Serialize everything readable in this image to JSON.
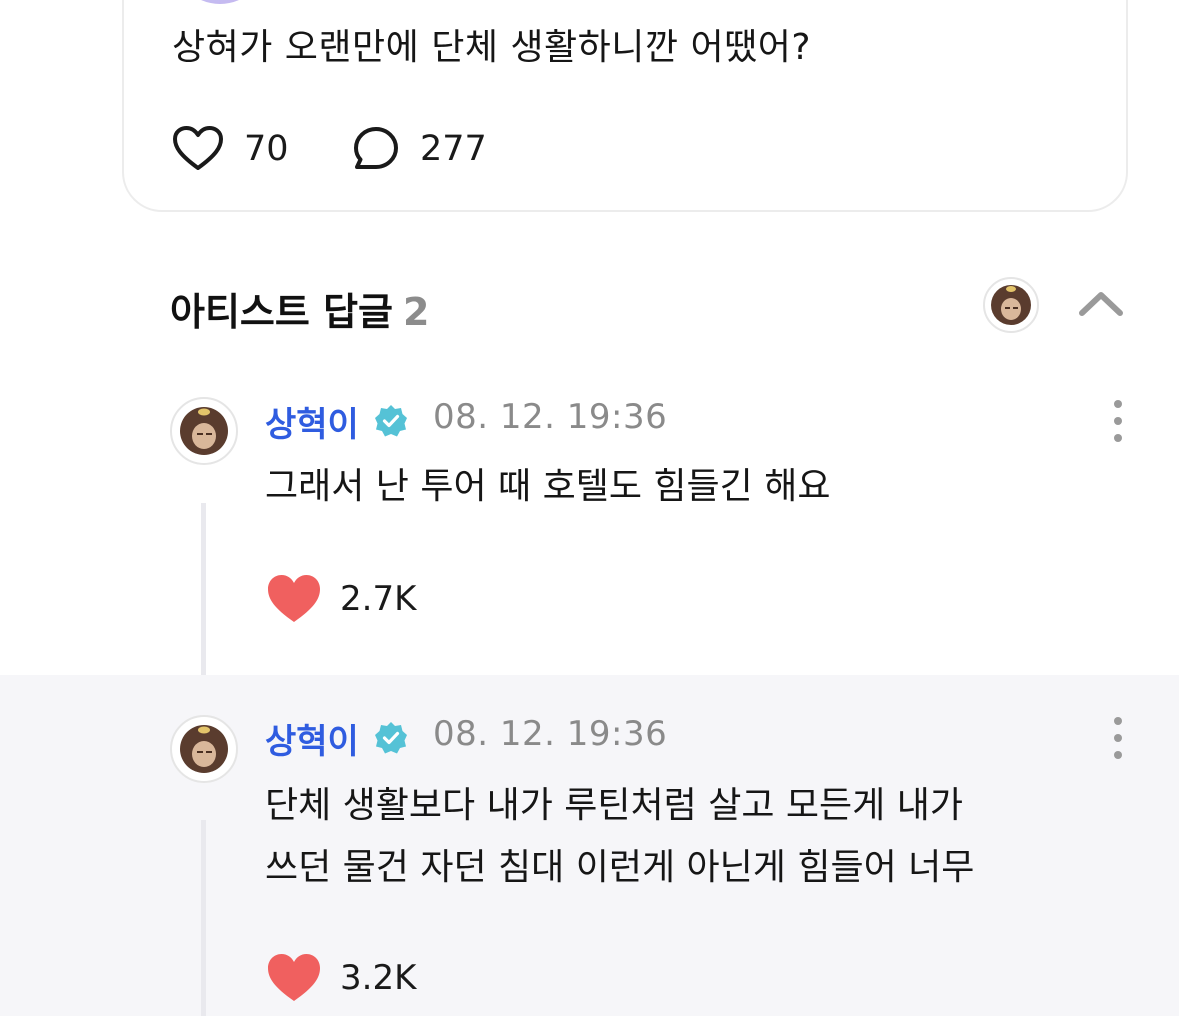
{
  "post": {
    "text": "상혀가 오랜만에 단체 생활하니깐 어땠어?",
    "likes": "70",
    "comments": "277"
  },
  "artist_replies": {
    "title": "아티스트 답글",
    "count": "2"
  },
  "replies": [
    {
      "author": "상혁이",
      "timestamp": "08. 12. 19:36",
      "text_lines": [
        "그래서 난 투어 때 호텔도 힘들긴 해요"
      ],
      "likes": "2.7K"
    },
    {
      "author": "상혁이",
      "timestamp": "08. 12. 19:36",
      "text_lines": [
        "단체 생활보다 내가 루틴처럼 살고 모든게 내가",
        "쓰던 물건 자던 침대 이런게 아닌게 힘들어 너무"
      ],
      "likes": "3.2K"
    }
  ],
  "colors": {
    "author": "#2f5ce0",
    "verified": "#55c2d6",
    "heart_filled": "#f0605f",
    "muted": "#8a8a8a",
    "reply_highlight_bg": "#f6f6f9"
  },
  "icons": {
    "like_outline": "heart-outline-icon",
    "comment": "speech-bubble-icon",
    "collapse": "chevron-up-icon",
    "verified": "verified-badge-icon",
    "more": "more-vertical-icon",
    "like_filled": "heart-filled-icon"
  }
}
